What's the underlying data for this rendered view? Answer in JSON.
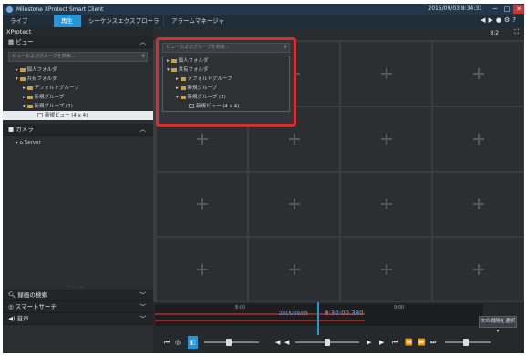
{
  "app": {
    "title": "Milestone XProtect Smart Client",
    "datetime": "2015/09/03 8:34:31"
  },
  "tabs": [
    {
      "label": "ライブ"
    },
    {
      "label": "再生"
    },
    {
      "label": "シーケンスエクスプローラ"
    },
    {
      "label": "アラームマネージャ"
    }
  ],
  "sidebar": {
    "header": "XProtect",
    "views_section": "ビュー",
    "search_placeholder": "ビューおよびグループを検索...",
    "tree": [
      {
        "label": "個人フォルダ",
        "indent": 1,
        "arrow": "▸"
      },
      {
        "label": "共有フォルダ",
        "indent": 1,
        "arrow": "▾"
      },
      {
        "label": "デフォルトグループ",
        "indent": 2,
        "arrow": "▸"
      },
      {
        "label": "新規グループ",
        "indent": 2,
        "arrow": "▸"
      },
      {
        "label": "新規グループ (2)",
        "indent": 2,
        "arrow": "▾"
      },
      {
        "label": "新規ビュー (4 x 4)",
        "indent": 3,
        "arrow": "",
        "selected": true
      }
    ],
    "cameras_section": "カメラ",
    "server_label": "Server",
    "bottom_sections": [
      {
        "label": "録画の検索"
      },
      {
        "label": "スマートサーチ"
      },
      {
        "label": "音声"
      }
    ]
  },
  "popup": {
    "search_placeholder": "ビューおよびグループを検索...",
    "tree": [
      {
        "label": "個人フォルダ",
        "indent": 0,
        "arrow": "▸"
      },
      {
        "label": "共有フォルダ",
        "indent": 0,
        "arrow": "▾"
      },
      {
        "label": "デフォルトグループ",
        "indent": 1,
        "arrow": "▸"
      },
      {
        "label": "新規グループ",
        "indent": 1,
        "arrow": "▸"
      },
      {
        "label": "新規グループ (2)",
        "indent": 1,
        "arrow": "▾"
      },
      {
        "label": "新規ビュー (4 x 4)",
        "indent": 2,
        "arrow": ""
      }
    ]
  },
  "main": {
    "top_right_label": "8:2"
  },
  "timeline": {
    "current_time": "8:30:00.380",
    "date": "2015/09/03",
    "tick_left": "8:00",
    "tick_right": "9:00",
    "time_select_label": "次の間隔を選択"
  },
  "colors": {
    "accent": "#2596d8",
    "highlight": "#d32f2f"
  }
}
